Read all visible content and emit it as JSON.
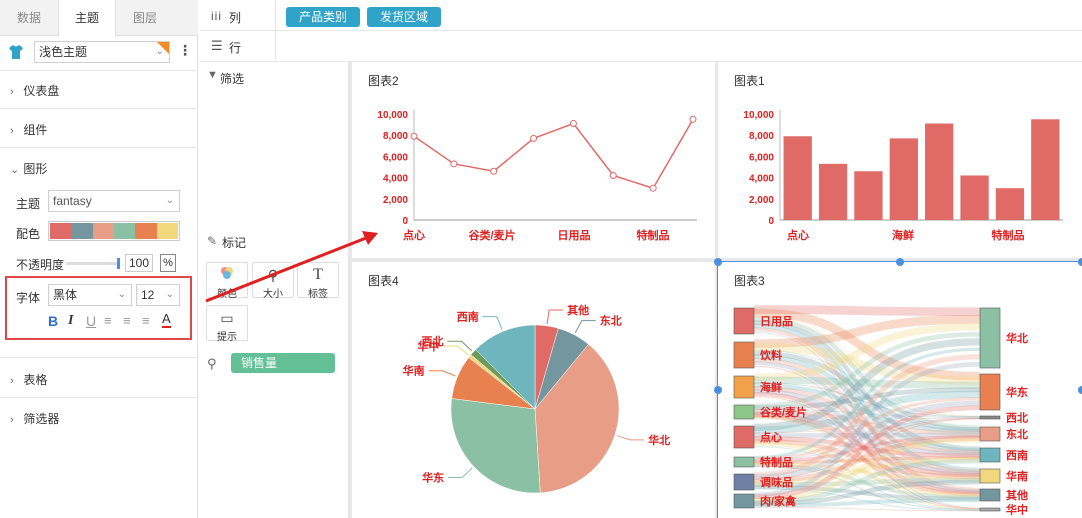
{
  "left": {
    "tabs": [
      "数据",
      "主题",
      "图层"
    ],
    "theme_select": "浅色主题",
    "sections": {
      "dashboard": "仪表盘",
      "component": "组件",
      "graphic": "图形",
      "table": "表格",
      "filter": "筛选器"
    },
    "graphic": {
      "theme_label": "主题",
      "theme_value": "fantasy",
      "palette_label": "配色",
      "palette": [
        "#e06a66",
        "#74979f",
        "#e89d86",
        "#8cc0a5",
        "#e8804f",
        "#f1d87c"
      ],
      "opacity_label": "不透明度",
      "opacity_value": "100",
      "opacity_unit": "%",
      "font_label": "字体",
      "font_family": "黑体",
      "font_size": "12",
      "format_buttons": [
        "B",
        "I",
        "U"
      ]
    }
  },
  "topbar": {
    "columns_label": "列",
    "rows_label": "行",
    "column_fields": [
      "产品类别",
      "发货区域"
    ]
  },
  "middle": {
    "filter_label": "筛选",
    "marks_label": "标记",
    "mark_buttons": [
      "颜色",
      "大小",
      "标签",
      "提示"
    ],
    "measure_pill": "销售量"
  },
  "charts": {
    "chart2_title": "图表2",
    "chart1_title": "图表1",
    "chart4_title": "图表4",
    "chart3_title": "图表3"
  },
  "chart_data": [
    {
      "type": "line",
      "title": "图表2",
      "y_ticks": [
        "0",
        "2,000",
        "4,000",
        "6,000",
        "8,000",
        "10,000"
      ],
      "ylim": [
        0,
        10000
      ],
      "x_tick_labels": [
        "点心",
        "谷类/麦片",
        "日用品",
        "特制品"
      ],
      "values": [
        7900,
        5300,
        4600,
        7700,
        9100,
        4200,
        3000,
        9500
      ]
    },
    {
      "type": "bar",
      "title": "图表1",
      "y_ticks": [
        "0",
        "2,000",
        "4,000",
        "6,000",
        "8,000",
        "10,000"
      ],
      "ylim": [
        0,
        10000
      ],
      "x_tick_labels": [
        "点心",
        "海鲜",
        "特制品"
      ],
      "values": [
        7900,
        5300,
        4600,
        7700,
        9100,
        4200,
        3000,
        9500
      ]
    },
    {
      "type": "pie",
      "title": "图表4",
      "slices": [
        {
          "name": "其他",
          "value": 4.5,
          "color": "#e06a66"
        },
        {
          "name": "东北",
          "value": 6.5,
          "color": "#74979f"
        },
        {
          "name": "华北",
          "value": 38,
          "color": "#e89d86"
        },
        {
          "name": "华东",
          "value": 28,
          "color": "#8cc0a5"
        },
        {
          "name": "华南",
          "value": 8.5,
          "color": "#e8804f"
        },
        {
          "name": "华中",
          "value": 0.7,
          "color": "#f1d87c"
        },
        {
          "name": "西北",
          "value": 1.3,
          "color": "#6e9a5c"
        },
        {
          "name": "西南",
          "value": 12.5,
          "color": "#6fb5bd"
        }
      ]
    },
    {
      "type": "sankey",
      "title": "图表3",
      "left_nodes": [
        {
          "name": "日用品",
          "color": "#e06a66"
        },
        {
          "name": "饮料",
          "color": "#e8804f"
        },
        {
          "name": "海鲜",
          "color": "#f1a24a"
        },
        {
          "name": "谷类/麦片",
          "color": "#8cc78a"
        },
        {
          "name": "点心",
          "color": "#e06a66"
        },
        {
          "name": "特制品",
          "color": "#8cc0a5"
        },
        {
          "name": "调味品",
          "color": "#6f7fa6"
        },
        {
          "name": "肉/家禽",
          "color": "#74979f"
        }
      ],
      "right_nodes": [
        {
          "name": "华北",
          "color": "#8cc0a5"
        },
        {
          "name": "华东",
          "color": "#e8804f"
        },
        {
          "name": "西北",
          "color": "#888888"
        },
        {
          "name": "东北",
          "color": "#e89d86"
        },
        {
          "name": "西南",
          "color": "#6fb5bd"
        },
        {
          "name": "华南",
          "color": "#f1d87c"
        },
        {
          "name": "其他",
          "color": "#74979f"
        },
        {
          "name": "华中",
          "color": "#aaaaaa"
        }
      ]
    }
  ]
}
